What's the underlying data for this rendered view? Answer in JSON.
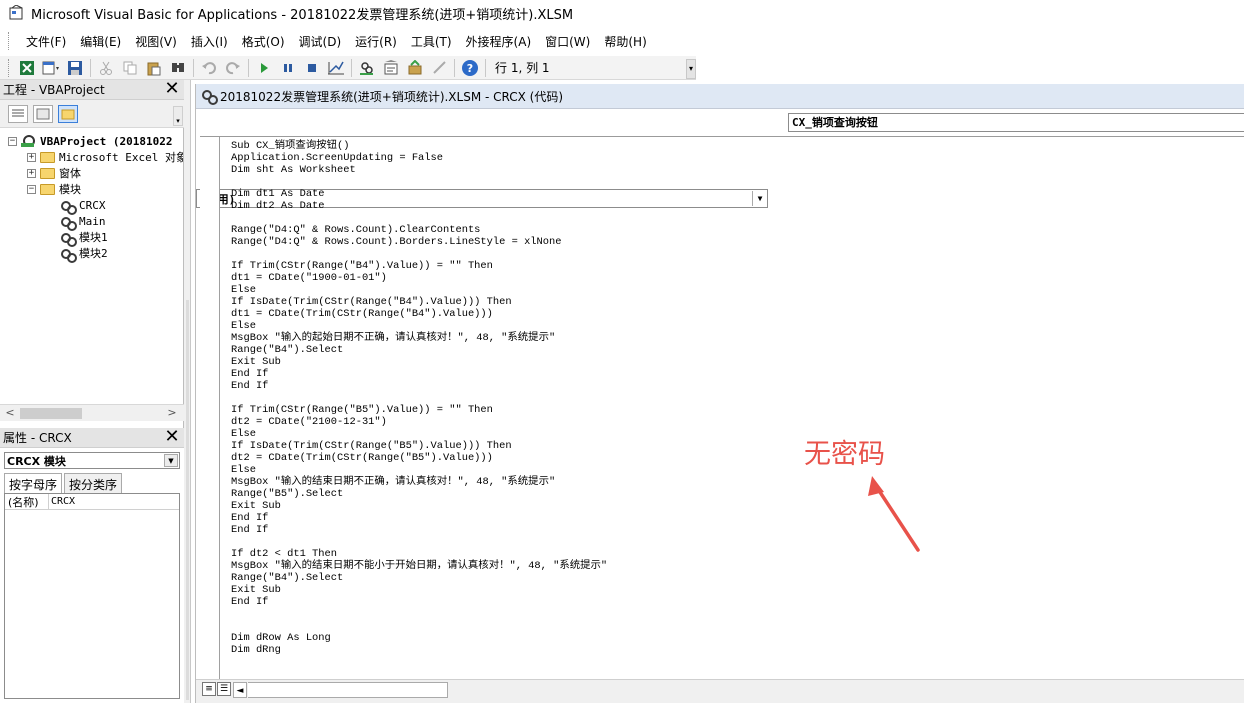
{
  "window": {
    "title": "Microsoft Visual Basic for Applications - 20181022发票管理系统(进项+销项统计).XLSM"
  },
  "menu": {
    "items": [
      "文件(F)",
      "编辑(E)",
      "视图(V)",
      "插入(I)",
      "格式(O)",
      "调试(D)",
      "运行(R)",
      "工具(T)",
      "外接程序(A)",
      "窗口(W)",
      "帮助(H)"
    ]
  },
  "toolbar": {
    "cursor_position": "行 1, 列 1",
    "icons": [
      "excel-icon",
      "insert-module-icon",
      "save-icon",
      "cut-icon",
      "copy-icon",
      "paste-icon",
      "find-icon",
      "undo-icon",
      "redo-icon",
      "run-icon",
      "break-icon",
      "reset-icon",
      "design-mode-icon",
      "project-explorer-icon",
      "properties-icon",
      "object-browser-icon",
      "toolbox-icon",
      "help-icon"
    ]
  },
  "project_panel": {
    "title": "工程 - VBAProject",
    "close": "✕",
    "tree": {
      "root": "VBAProject (20181022",
      "excel_objects": "Microsoft Excel 对象",
      "forms": "窗体",
      "modules": "模块",
      "module_items": [
        "CRCX",
        "Main",
        "模块1",
        "模块2"
      ]
    }
  },
  "properties_panel": {
    "title": "属性 - CRCX",
    "close": "✕",
    "object_select": "CRCX 模块",
    "tabs": [
      "按字母序",
      "按分类序"
    ],
    "rows": [
      {
        "key": "(名称)",
        "value": "CRCX"
      }
    ]
  },
  "code_window": {
    "title": "20181022发票管理系统(进项+销项统计).XLSM - CRCX (代码)",
    "object_combo": "(通用)",
    "procedure_combo": "CX_销项查询按钮",
    "code_lines": [
      "Sub CX_销项查询按钮()",
      "Application.ScreenUpdating = False",
      "Dim sht As Worksheet",
      "",
      "Dim dt1 As Date",
      "Dim dt2 As Date",
      "",
      "Range(\"D4:Q\" & Rows.Count).ClearContents",
      "Range(\"D4:Q\" & Rows.Count).Borders.LineStyle = xlNone",
      "",
      "If Trim(CStr(Range(\"B4\").Value)) = \"\" Then",
      "dt1 = CDate(\"1900-01-01\")",
      "Else",
      "If IsDate(Trim(CStr(Range(\"B4\").Value))) Then",
      "dt1 = CDate(Trim(CStr(Range(\"B4\").Value)))",
      "Else",
      "MsgBox \"输入的起始日期不正确，请认真核对！\", 48, \"系统提示\"",
      "Range(\"B4\").Select",
      "Exit Sub",
      "End If",
      "End If",
      "",
      "If Trim(CStr(Range(\"B5\").Value)) = \"\" Then",
      "dt2 = CDate(\"2100-12-31\")",
      "Else",
      "If IsDate(Trim(CStr(Range(\"B5\").Value))) Then",
      "dt2 = CDate(Trim(CStr(Range(\"B5\").Value)))",
      "Else",
      "MsgBox \"输入的结束日期不正确，请认真核对！\", 48, \"系统提示\"",
      "Range(\"B5\").Select",
      "Exit Sub",
      "End If",
      "End If",
      "",
      "If dt2 < dt1 Then",
      "MsgBox \"输入的结束日期不能小于开始日期，请认真核对！\", 48, \"系统提示\"",
      "Range(\"B4\").Select",
      "Exit Sub",
      "End If",
      "",
      "",
      "Dim dRow As Long",
      "Dim dRng"
    ]
  },
  "annotation": {
    "text": "无密码",
    "color": "#e8524a"
  }
}
